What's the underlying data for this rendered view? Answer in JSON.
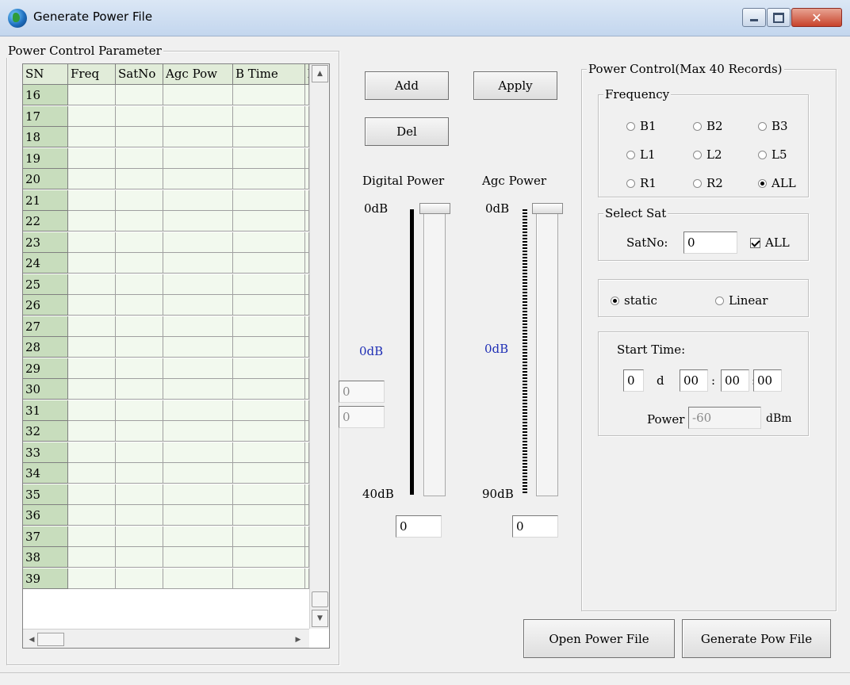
{
  "window": {
    "title": "Generate Power File",
    "close_glyph": "✕"
  },
  "left_group": {
    "title": "Power Control Parameter"
  },
  "grid": {
    "columns": [
      "SN",
      "Freq",
      "SatNo",
      "Agc Pow",
      "B Time",
      "l"
    ],
    "rows": [
      "16",
      "17",
      "18",
      "19",
      "20",
      "21",
      "22",
      "23",
      "24",
      "25",
      "26",
      "27",
      "28",
      "29",
      "30",
      "31",
      "32",
      "33",
      "34",
      "35",
      "36",
      "37",
      "38",
      "39"
    ]
  },
  "buttons": {
    "add": "Add",
    "apply": "Apply",
    "del": "Del",
    "open_power_file": "Open Power File",
    "generate_pow_file": "Generate Pow File"
  },
  "digital_power": {
    "label": "Digital Power",
    "top": "0dB",
    "bottom": "40dB",
    "current": "0dB",
    "value": "0",
    "level": 0
  },
  "agc_power": {
    "label": "Agc Power",
    "top": "0dB",
    "bottom": "90dB",
    "current": "0dB",
    "value": "0",
    "level": 0
  },
  "side_fields": {
    "field1": "0",
    "field2": "0"
  },
  "power_control": {
    "title": "Power Control(Max 40 Records)",
    "frequency": {
      "title": "Frequency",
      "options": [
        {
          "label": "B1",
          "selected": false
        },
        {
          "label": "B2",
          "selected": false
        },
        {
          "label": "B3",
          "selected": false
        },
        {
          "label": "L1",
          "selected": false
        },
        {
          "label": "L2",
          "selected": false
        },
        {
          "label": "L5",
          "selected": false
        },
        {
          "label": "R1",
          "selected": false
        },
        {
          "label": "R2",
          "selected": false
        },
        {
          "label": "ALL",
          "selected": true
        }
      ]
    },
    "select_sat": {
      "title": "Select Sat",
      "satno_label": "SatNo:",
      "satno_value": "0",
      "all_label": "ALL",
      "all_checked": true
    },
    "mode": {
      "static_label": "static",
      "linear_label": "Linear",
      "selected": "static"
    },
    "start_time": {
      "label": "Start Time:",
      "days": "0",
      "d_label": "d",
      "hh": "00",
      "mm": "00",
      "ss": "00",
      "sep": ":"
    },
    "power": {
      "label": "Power",
      "value": "-60",
      "unit": "dBm"
    }
  },
  "colors": {
    "grid_header_bg": "#e1ecd9",
    "row_header_bg": "#c8ddbd",
    "cell_bg": "#f2f9ee",
    "marker_blue": "#1f2fb5"
  }
}
